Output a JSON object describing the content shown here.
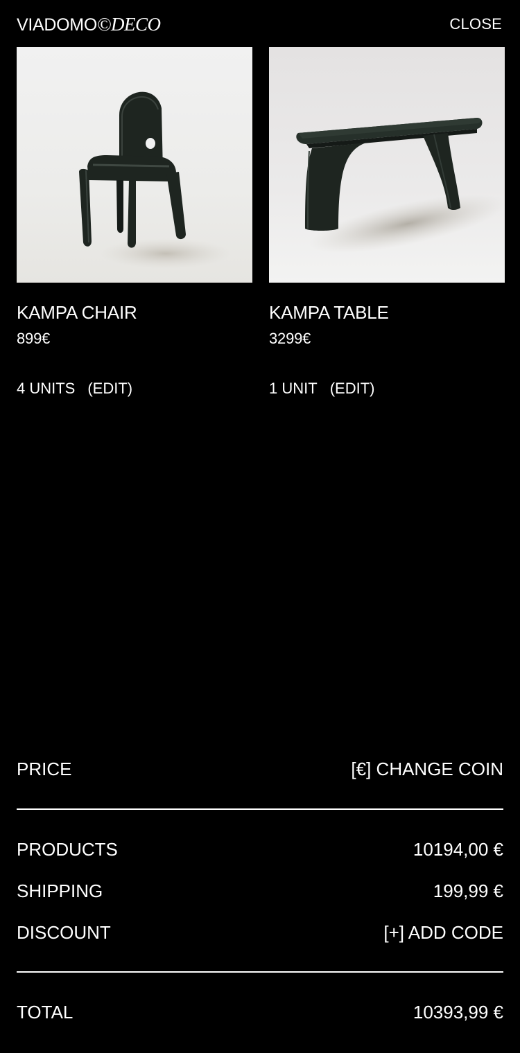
{
  "header": {
    "brand": "VIADOMO",
    "brand_mark": "©DECO",
    "close_label": "CLOSE"
  },
  "cart": {
    "items": [
      {
        "name": "KAMPA CHAIR",
        "price": "899€",
        "quantity": "4 UNITS",
        "edit_label": "(EDIT)",
        "image_icon": "chair-photo"
      },
      {
        "name": "KAMPA TABLE",
        "price": "3299€",
        "quantity": "1 UNIT",
        "edit_label": "(EDIT)",
        "image_icon": "table-photo"
      }
    ]
  },
  "summary": {
    "price_label": "PRICE",
    "change_coin_label": "[€] CHANGE COIN",
    "products_label": "PRODUCTS",
    "products_value": "10194,00 €",
    "shipping_label": "SHIPPING",
    "shipping_value": "199,99 €",
    "discount_label": "DISCOUNT",
    "add_code_label": "[+] ADD CODE",
    "total_label": "TOTAL",
    "total_value": "10393,99 €"
  },
  "colors": {
    "background": "#000000",
    "text": "#ffffff",
    "product_finish": "#1e2520"
  }
}
